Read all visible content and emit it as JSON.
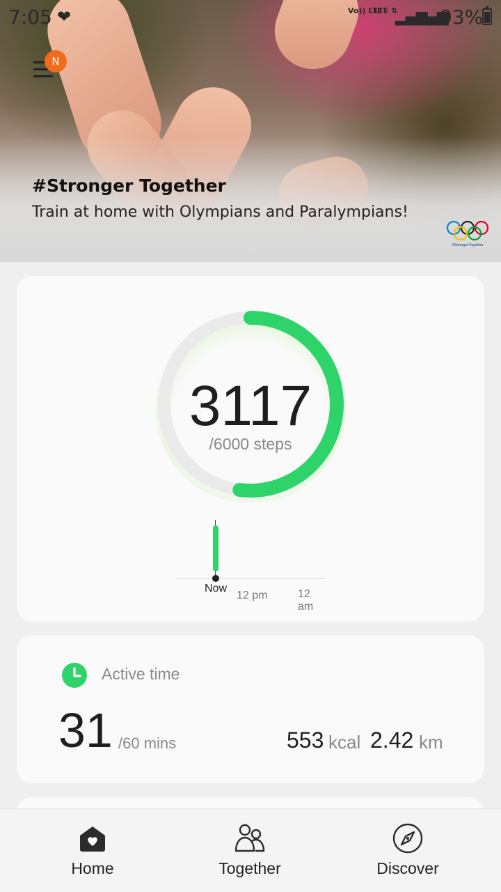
{
  "status_bar": {
    "time": "7:05",
    "signal_labels": [
      "Vo)) LTE",
      "LTE ⇅"
    ],
    "battery_percent": "93%",
    "icons": [
      "heart-icon",
      "signal-icon",
      "battery-icon"
    ]
  },
  "header": {
    "notification_badge": "N",
    "banner_title": "#Stronger Together",
    "banner_subtitle": "Train at home with Olympians and Paralympians!",
    "logo_caption": "#StrongerTogether"
  },
  "steps": {
    "value": "3117",
    "goal_label": "/6000 steps",
    "progress": 0.52,
    "accent_color": "#2ed36a",
    "timeline": {
      "now_label": "Now",
      "tick_mid": "12 pm",
      "tick_end": "12 am"
    }
  },
  "active_time": {
    "label": "Active time",
    "value": "31",
    "goal_label": "/60 mins",
    "kcal_value": "553",
    "kcal_unit": "kcal",
    "distance_value": "2.42",
    "distance_unit": "km"
  },
  "bottom_nav": {
    "home": "Home",
    "together": "Together",
    "discover": "Discover"
  }
}
